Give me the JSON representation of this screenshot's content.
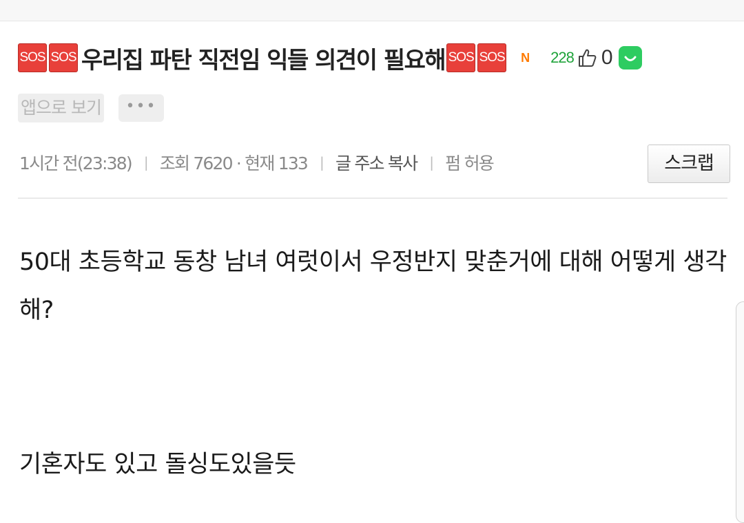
{
  "post": {
    "badge_text": "SOS",
    "title": "우리집 파탄 직전임 익들 의견이 필요해",
    "new_badge": "N",
    "comment_count": "228",
    "like_count": "0",
    "app_view_label": "앱으로 보기",
    "more_label": "•••",
    "meta": {
      "time": "1시간 전(23:38)",
      "views": "조회 7620 · 현재 133",
      "copy_url": "글 주소 복사",
      "permission": "펌 허용",
      "separator": "|"
    },
    "scrap_label": "스크랩",
    "body_line1": "50대 초등학교 동창 남녀 여럿이서 우정반지 맞춘거에 대해 어떻게 생각해?",
    "body_line2": "기혼자도 있고 돌싱도있을듯"
  },
  "colors": {
    "sos_red": "#e8403a",
    "comment_green": "#1fa33a",
    "new_orange": "#ff7a00",
    "smile_green": "#2ecc61"
  },
  "icons": [
    "sos-badge",
    "new-badge",
    "thumbs-up-icon",
    "smile-icon"
  ]
}
